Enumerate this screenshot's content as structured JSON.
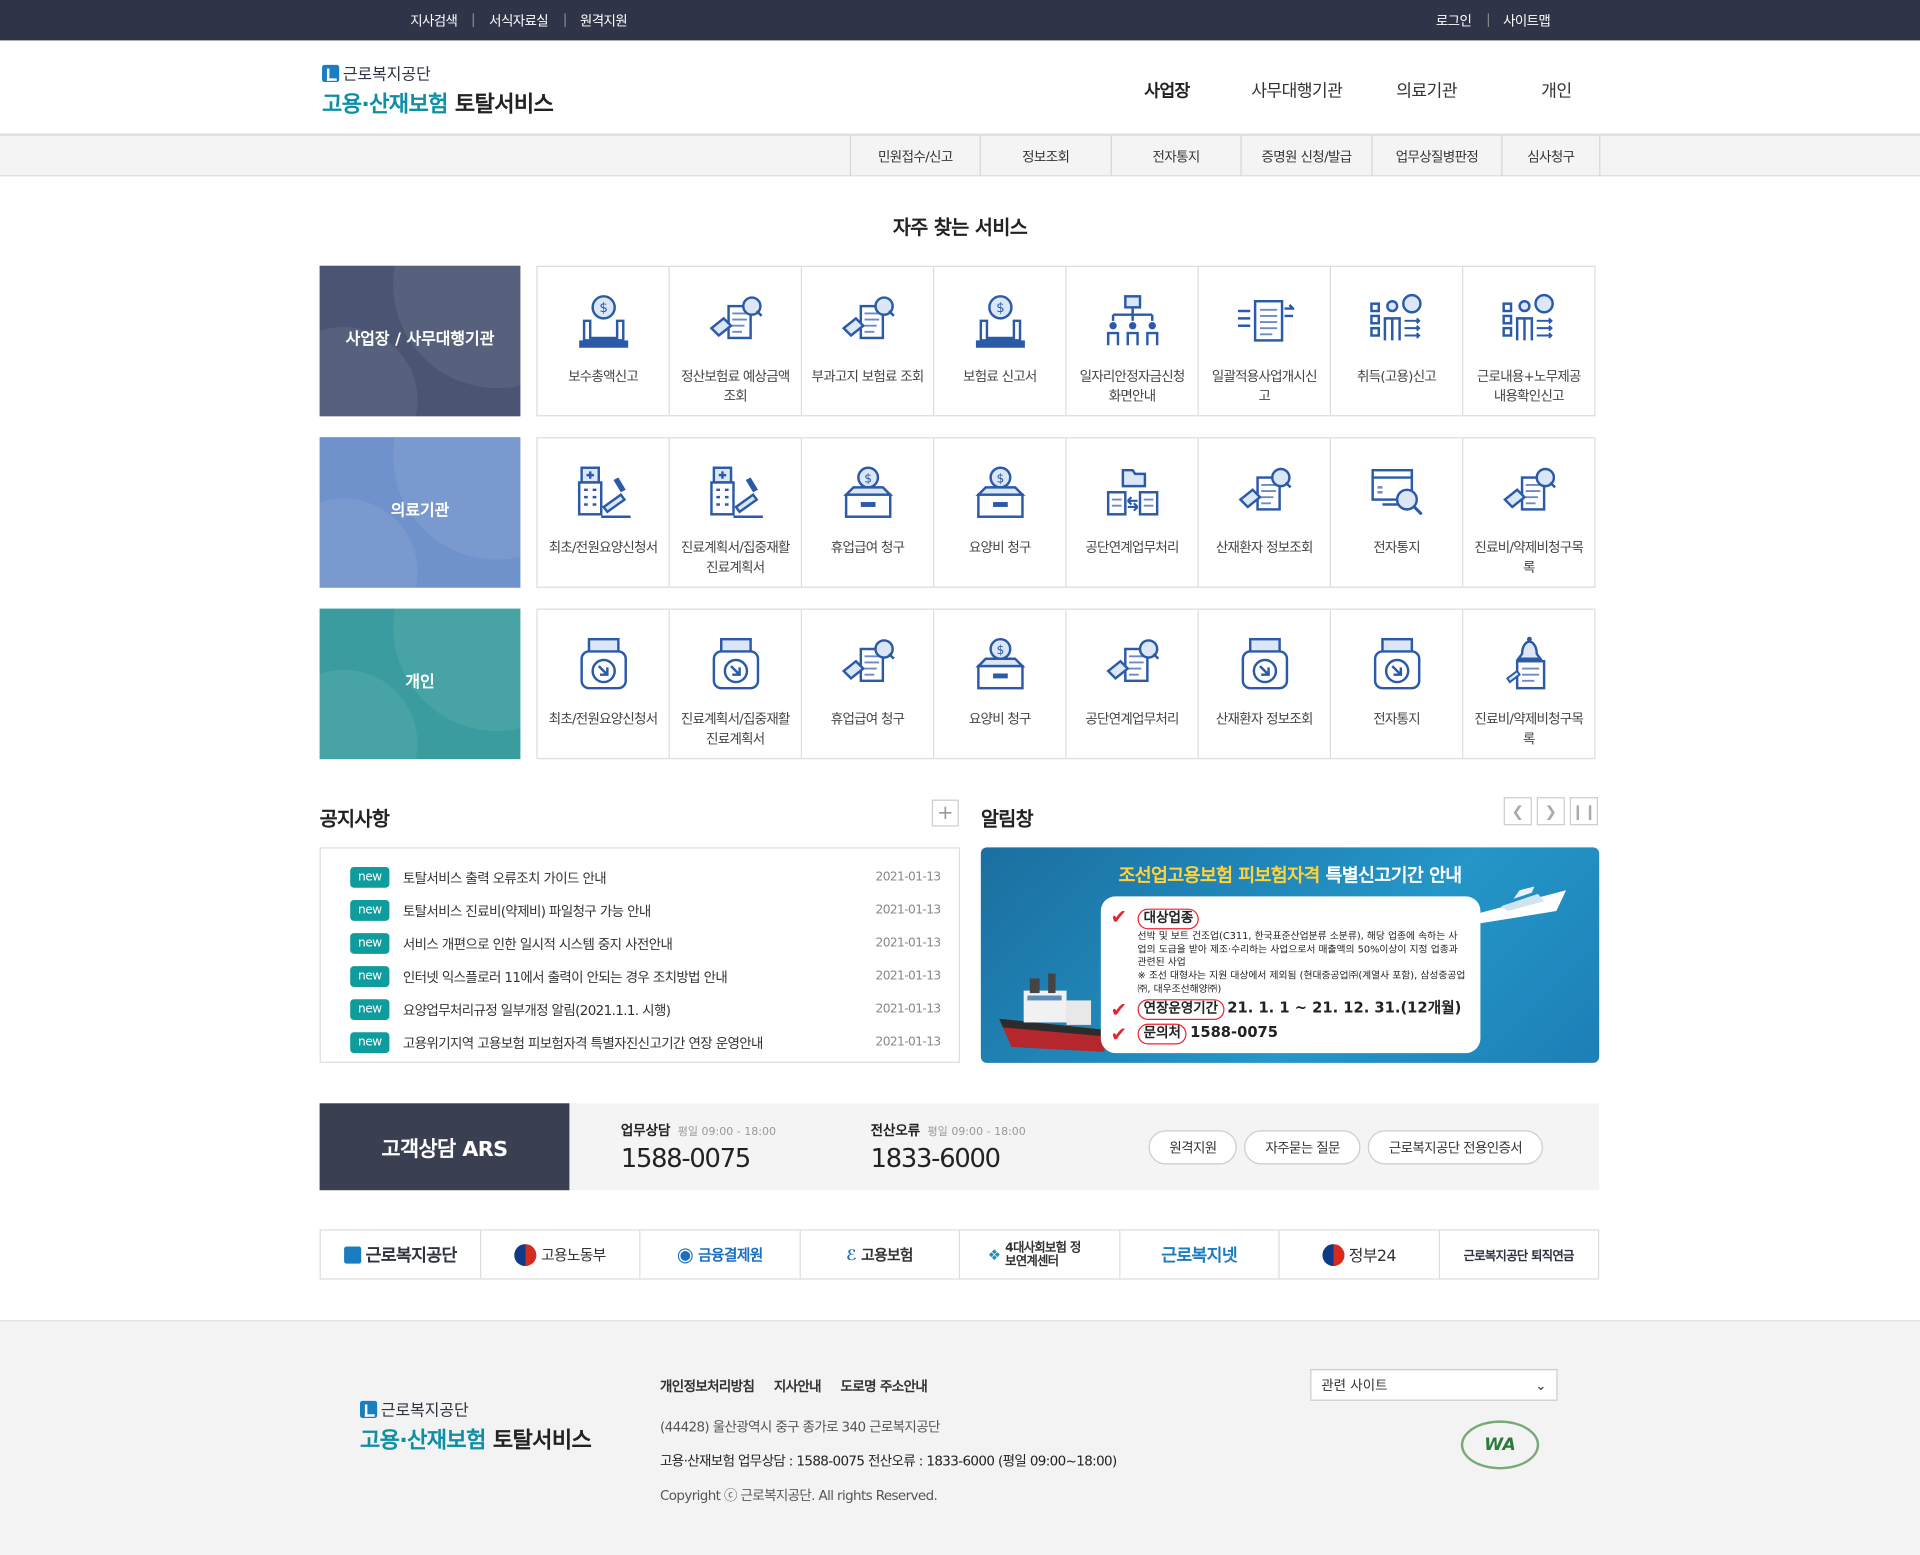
{
  "topbar": {
    "left": [
      "지사검색",
      "서식자료실",
      "원격지원"
    ],
    "right": [
      "로그인",
      "사이트맵"
    ]
  },
  "header": {
    "org": "근로복지공단",
    "service_teal": "고용·산재보험",
    "service_dark": "토탈서비스",
    "gnb": [
      "사업장",
      "사무대행기관",
      "의료기관",
      "개인"
    ]
  },
  "subnav": [
    "민원접수/신고",
    "정보조회",
    "전자통지",
    "증명원 신청/발급",
    "업무상질병판정",
    "심사청구"
  ],
  "services": {
    "title": "자주 찾는 서비스",
    "rows": [
      {
        "category": "사업장 / 사무대행기관",
        "color": "#4b5473",
        "items": [
          {
            "label": "보수총액신고",
            "icon": "money-hand-icon"
          },
          {
            "label": "정산보험료 예상금액 조회",
            "icon": "document-search-icon"
          },
          {
            "label": "부과고지 보험료 조회",
            "icon": "document-search-icon"
          },
          {
            "label": "보험료 신고서",
            "icon": "money-hand-icon"
          },
          {
            "label": "일자리안정자금신청화면안내",
            "icon": "org-chart-icon"
          },
          {
            "label": "일괄적용사업개시신고",
            "icon": "document-transfer-icon"
          },
          {
            "label": "취득(고용)신고",
            "icon": "person-checklist-icon"
          },
          {
            "label": "근로내용+노무제공내용확인신고",
            "icon": "person-checklist-icon"
          }
        ]
      },
      {
        "category": "의료기관",
        "color": "#6f92cc",
        "items": [
          {
            "label": "최초/전원요양신청서",
            "icon": "hospital-write-icon"
          },
          {
            "label": "진료계획서/집중재활진료계획서",
            "icon": "hospital-write-icon"
          },
          {
            "label": "휴업급여 청구",
            "icon": "money-box-icon"
          },
          {
            "label": "요양비 청구",
            "icon": "money-box-icon"
          },
          {
            "label": "공단연계업무처리",
            "icon": "folder-exchange-icon"
          },
          {
            "label": "산재환자 정보조회",
            "icon": "document-search-icon"
          },
          {
            "label": "전자통지",
            "icon": "monitor-search-icon"
          },
          {
            "label": "진료비/약제비청구목록",
            "icon": "document-search-icon"
          }
        ]
      },
      {
        "category": "개인",
        "color": "#3a9c9e",
        "items": [
          {
            "label": "최초/전원요양신청서",
            "icon": "print-arrow-icon"
          },
          {
            "label": "진료계획서/집중재활진료계획서",
            "icon": "print-arrow-icon"
          },
          {
            "label": "휴업급여 청구",
            "icon": "document-search-icon"
          },
          {
            "label": "요양비 청구",
            "icon": "money-box-icon"
          },
          {
            "label": "공단연계업무처리",
            "icon": "document-search-icon"
          },
          {
            "label": "산재환자 정보조회",
            "icon": "print-arrow-icon"
          },
          {
            "label": "전자통지",
            "icon": "print-arrow-icon"
          },
          {
            "label": "진료비/약제비청구목록",
            "icon": "bell-document-icon"
          }
        ]
      }
    ]
  },
  "notice": {
    "title": "공지사항",
    "plus": "+",
    "badge": "new",
    "items": [
      {
        "title": "토탈서비스 출력 오류조치 가이드 안내",
        "date": "2021-01-13"
      },
      {
        "title": "토탈서비스 진료비(약제비) 파일청구 가능 안내",
        "date": "2021-01-13"
      },
      {
        "title": "서비스 개편으로 인한 일시적 시스템 중지 사전안내",
        "date": "2021-01-13"
      },
      {
        "title": "인터넷 익스플로러 11에서 출력이 안되는 경우 조치방법 안내",
        "date": "2021-01-13"
      },
      {
        "title": "요양업무처리규정 일부개정 알림(2021.1.1. 시행)",
        "date": "2021-01-13"
      },
      {
        "title": "고용위기지역 고용보험 피보험자격 특별자진신고기간 연장 운영안내",
        "date": "2021-01-13"
      }
    ]
  },
  "alert": {
    "title": "알림창",
    "banner": {
      "title_a": "조선업",
      "title_b": "고용보험 피보험자격",
      "title_c": "특별신고기간 안내",
      "label1": "대상업종",
      "text1": "선박 및 보트 건조업(C311, 한국표준산업분류 소분류), 해당 업종에 속하는 사업의 도급을 받아 제조·수리하는 사업으로서 매출액의 50%이상이 지정 업종과 관련된 사업",
      "text2": "※ 조선 대형사는 지원 대상에서 제외됨 (현대중공업㈜(계열사 포함), 삼성중공업㈜, 대우조선해양㈜)",
      "label2": "연장운영기간",
      "period": "21. 1. 1 ~ 21. 12. 31.(12개월)",
      "label3": "문의처",
      "phone": "1588-0075"
    }
  },
  "ars": {
    "title": "고객상담 ARS",
    "work_label": "업무상담",
    "work_hours": "평일 09:00 - 18:00",
    "work_phone": "1588-0075",
    "err_label": "전산오류",
    "err_hours": "평일 09:00 - 18:00",
    "err_phone": "1833-6000",
    "buttons": [
      "원격지원",
      "자주묻는 질문",
      "근로복지공단 전용인증서"
    ]
  },
  "partners": [
    "근로복지공단",
    "고용노동부",
    "금융결제원",
    "고용보험",
    "4대사회보험 정보연계센터",
    "근로복지넷",
    "정부24",
    "근로복지공단 퇴직연금"
  ],
  "footer": {
    "org": "근로복지공단",
    "service_teal": "고용·산재보험",
    "service_dark": "토탈서비스",
    "links": [
      "개인정보처리방침",
      "지사안내",
      "도로명 주소안내"
    ],
    "address": "(44428) 울산광역시 중구 종가로 340 근로복지공단",
    "contact": "고용·산재보험 업무상담 : 1588-0075 전산오류 : 1833-6000 (평일 09:00~18:00)",
    "copyright": "Copyright ⓒ 근로복지공단. All rights Reserved.",
    "select": "관련 사이트",
    "wa_mark": "WA"
  }
}
